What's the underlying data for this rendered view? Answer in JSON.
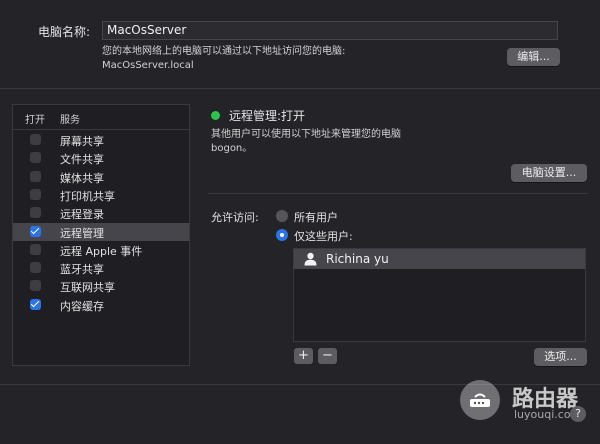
{
  "computer": {
    "name_label": "电脑名称:",
    "name_value": "MacOsServer",
    "access_text": "您的本地网络上的电脑可以通过以下地址访问您的电脑:",
    "local_address": "MacOsServer.local",
    "edit_button": "编辑..."
  },
  "services": {
    "header_on": "打开",
    "header_service": "服务",
    "items": [
      {
        "label": "屏幕共享",
        "checked": false
      },
      {
        "label": "文件共享",
        "checked": false
      },
      {
        "label": "媒体共享",
        "checked": false
      },
      {
        "label": "打印机共享",
        "checked": false
      },
      {
        "label": "远程登录",
        "checked": false
      },
      {
        "label": "远程管理",
        "checked": true,
        "selected": true
      },
      {
        "label": "远程 Apple 事件",
        "checked": false
      },
      {
        "label": "蓝牙共享",
        "checked": false
      },
      {
        "label": "互联网共享",
        "checked": false
      },
      {
        "label": "内容缓存",
        "checked": true
      }
    ]
  },
  "detail": {
    "status": "远程管理:打开",
    "status_color": "#2dc44a",
    "desc": "其他用户可以使用以下地址来管理您的电脑",
    "address": "bogon。",
    "settings_button": "电脑设置...",
    "allow_label": "允许访问:",
    "option_all": "所有用户",
    "option_these": "仅这些用户:",
    "selected_option": "option_these",
    "users": [
      "Richina yu"
    ],
    "add_button": "+",
    "remove_button": "−",
    "options_button": "选项...",
    "help_button": "?"
  },
  "watermark": {
    "text": "路由器",
    "url": "luyouqi.com"
  },
  "accent_color": "#2a74e8"
}
